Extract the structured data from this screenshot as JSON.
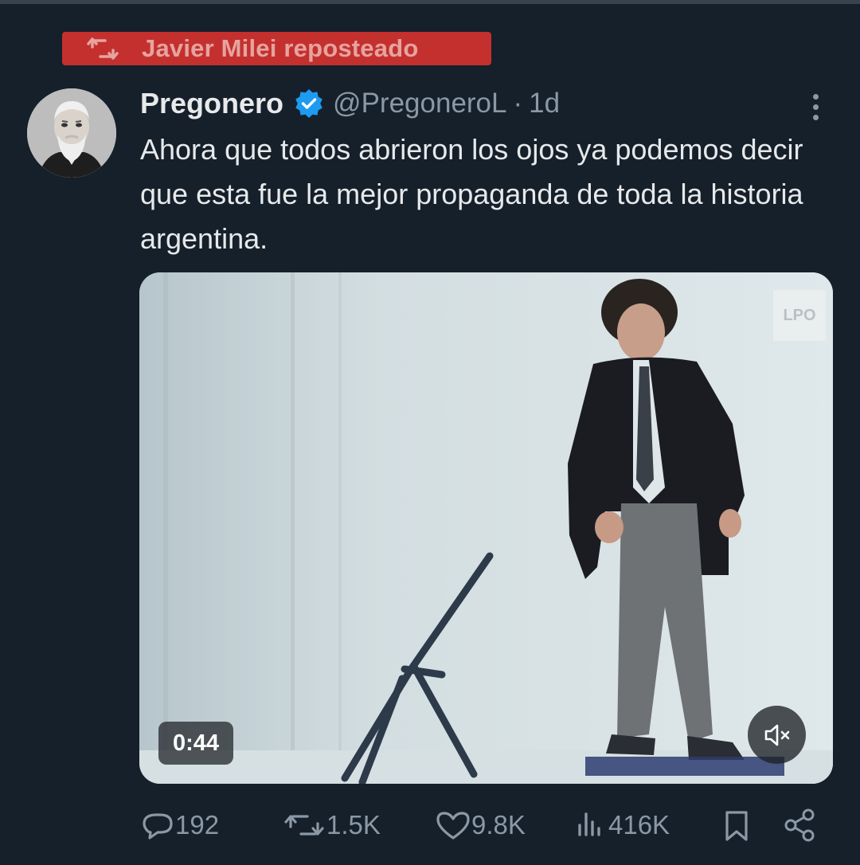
{
  "repost": {
    "label": "Javier Milei reposteado",
    "icon": "repost-icon",
    "highlight_color": "#c4302d"
  },
  "author": {
    "name": "Pregonero",
    "handle": "@PregoneroL",
    "separator": "·",
    "time": "1d",
    "verified": true,
    "verified_color": "#1d9bf0"
  },
  "tweet": {
    "text": "Ahora que todos abrieron los ojos ya podemos decir que esta fue la mejor propaganda de toda la historia argentina."
  },
  "media": {
    "watermark": "LPO",
    "duration": "0:44",
    "muted": true
  },
  "actions": {
    "replies": "192",
    "reposts": "1.5K",
    "likes": "9.8K",
    "views": "416K"
  },
  "colors": {
    "background": "#15202b",
    "text_primary": "#e7e9ea",
    "text_secondary": "#8b98a5"
  }
}
